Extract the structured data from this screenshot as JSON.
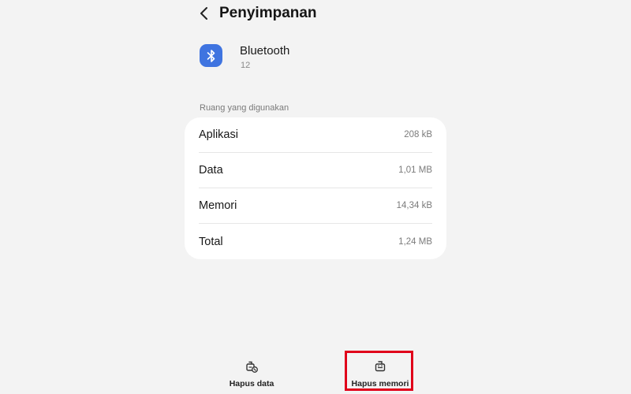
{
  "header": {
    "title": "Penyimpanan",
    "back_icon": "chevron-left-icon"
  },
  "app": {
    "name": "Bluetooth",
    "version": "12",
    "icon": "bluetooth-icon",
    "icon_color": "#3f74e0"
  },
  "storage": {
    "section_label": "Ruang yang digunakan",
    "rows": [
      {
        "label": "Aplikasi",
        "value": "208 kB"
      },
      {
        "label": "Data",
        "value": "1,01 MB"
      },
      {
        "label": "Memori",
        "value": "14,34 kB"
      },
      {
        "label": "Total",
        "value": "1,24 MB"
      }
    ]
  },
  "actions": {
    "clear_data": {
      "label": "Hapus data",
      "icon": "clear-data-icon"
    },
    "clear_cache": {
      "label": "Hapus memori",
      "icon": "clear-cache-icon"
    }
  },
  "highlight_color": "#e0001a"
}
